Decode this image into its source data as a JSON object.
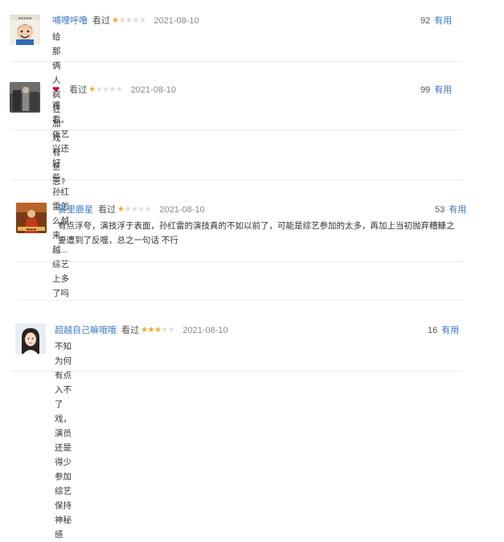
{
  "reviews": [
    {
      "username": "哺哩呼噜",
      "status": "看过",
      "rating": 1,
      "date": "2021-08-10",
      "votes": "92",
      "useful_label": "有用",
      "comment": "给那俩人疯狂加戏有意思?",
      "avatar_icon": "cartoon-avatar"
    },
    {
      "username": "",
      "status": "看过",
      "rating": 1,
      "date": "2021-08-10",
      "votes": "99",
      "useful_label": "有用",
      "comment": "难看。张艺兴还好些，孙红雷怎么越来越...综艺上多了吗",
      "avatar_icon": "photo-avatar",
      "badge_icon": "heart-icon"
    },
    {
      "username": "雾里鹿星",
      "status": "看过",
      "rating": 1,
      "date": "2021-08-10",
      "votes": "53",
      "useful_label": "有用",
      "comment_line1": "有点浮夸，演技浮于表面，孙红雷的演技真的不如以前了，可能是综艺参加的太多，再加上当初抛弃糟糠之",
      "comment_line2": "妻遭到了反噬，总之一句话 不行",
      "avatar_icon": "poster-avatar"
    },
    {
      "username": "超越自己嘛哦哦",
      "status": "看过",
      "rating": 3,
      "date": "2021-08-10",
      "votes": "16",
      "useful_label": "有用",
      "comment": "不知为何有点入不了戏，演员还是得少参加综艺保持神秘感",
      "avatar_icon": "girl-avatar"
    }
  ],
  "colors": {
    "link": "#3b78c5",
    "star_on": "#f5a623",
    "star_off": "#dddddd",
    "divider": "#ececec"
  }
}
